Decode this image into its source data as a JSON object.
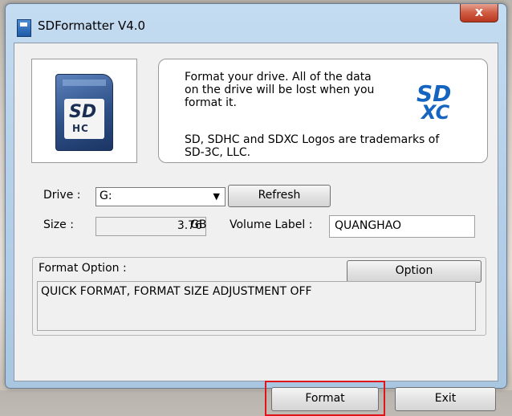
{
  "window": {
    "title": "SDFormatter V4.0",
    "close_label": "x"
  },
  "info": {
    "message": "Format your drive. All of the data\non the drive will be lost when you\nformat it.",
    "trademark": "SD, SDHC and SDXC Logos are trademarks of\nSD-3C, LLC.",
    "logo_sd": "SD",
    "logo_xc": "XC",
    "card_logo_sd": "SD",
    "card_logo_hc": "HC"
  },
  "drive": {
    "label": "Drive :",
    "value": "G:",
    "refresh_label": "Refresh"
  },
  "size": {
    "label": "Size :",
    "value": "3.76",
    "unit": "GB"
  },
  "volume": {
    "label": "Volume Label :",
    "value": "QUANGHAO"
  },
  "format_option": {
    "label": "Format Option :",
    "option_button": "Option",
    "summary": "QUICK FORMAT, FORMAT SIZE ADJUSTMENT OFF"
  },
  "actions": {
    "format_label": "Format",
    "exit_label": "Exit"
  },
  "colors": {
    "highlight": "#e0141b",
    "logo_blue": "#1565c0"
  }
}
